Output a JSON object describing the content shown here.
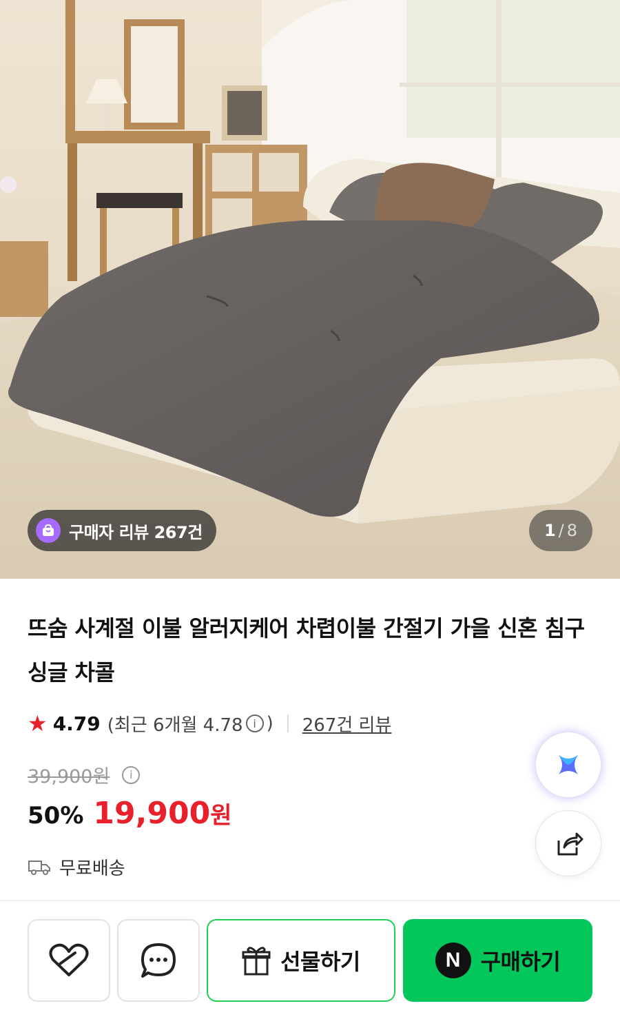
{
  "hero": {
    "buyer_review_chip": "구매자 리뷰 267건",
    "page_current": "1",
    "page_separator": "/",
    "page_total": "8"
  },
  "product": {
    "title": "뜨숨 사계절 이불 알러지케어 차렵이불 간절기 가을 신혼 침구 싱글 차콜",
    "rating": {
      "score": "4.79",
      "recent_prefix": "(최근 6개월 4.78",
      "recent_suffix": ")",
      "review_count_link": "267건 리뷰"
    },
    "original_price": "39,900원",
    "discount_rate": "50%",
    "sale_price": "19,900",
    "currency": "원",
    "shipping": "무료배송"
  },
  "bottom_bar": {
    "gift_label": "선물하기",
    "buy_label": "구매하기",
    "npay_mark": "N"
  },
  "colors": {
    "accent_red": "#e8202b",
    "naver_green": "#03c75a",
    "review_badge_purple": "#a86bff"
  },
  "icons": {
    "rating": "star-icon",
    "info": "info-icon",
    "shipping": "truck-icon",
    "ai": "ai-sparkle-icon",
    "share": "share-icon",
    "like": "heart-icon",
    "talk": "chat-icon",
    "gift": "gift-icon"
  }
}
